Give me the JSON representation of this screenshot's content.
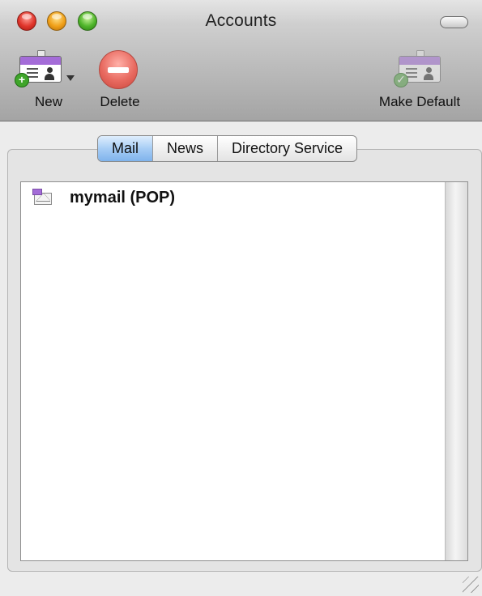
{
  "window": {
    "title": "Accounts"
  },
  "toolbar": {
    "new_label": "New",
    "delete_label": "Delete",
    "make_default_label": "Make Default"
  },
  "tabs": [
    {
      "label": "Mail",
      "selected": true
    },
    {
      "label": "News",
      "selected": false
    },
    {
      "label": "Directory Service",
      "selected": false
    }
  ],
  "accounts": [
    {
      "label": "mymail (POP)",
      "icon": "mail-account-icon"
    }
  ],
  "colors": {
    "tab_selected": "#a7cdf5",
    "card_band": "#a46cd8",
    "delete_red": "#e86a60"
  }
}
